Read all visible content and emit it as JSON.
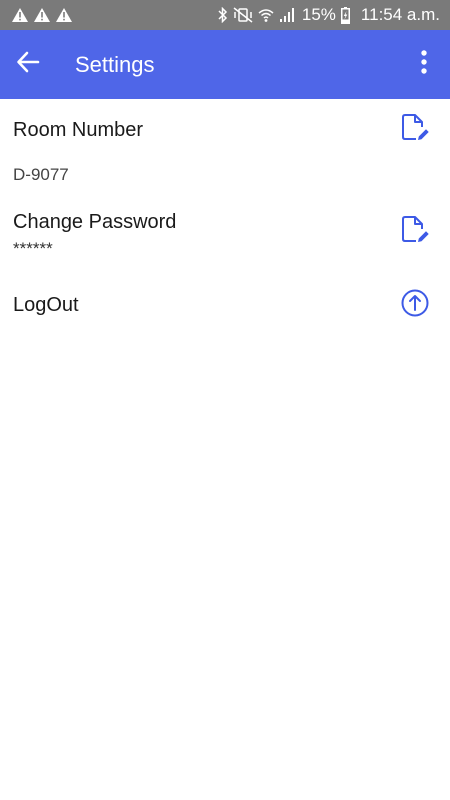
{
  "status_bar": {
    "battery": "15%",
    "time": "11:54 a.m."
  },
  "app_bar": {
    "title": "Settings"
  },
  "settings": {
    "room": {
      "label": "Room Number",
      "value": "D-9077"
    },
    "password": {
      "label": "Change Password",
      "value": "******"
    },
    "logout": {
      "label": "LogOut"
    }
  },
  "colors": {
    "accent": "#4f66e8",
    "status_bar": "#7a7a7a",
    "icon": "#3d5ae6"
  },
  "icons": {
    "back": "arrow-back-icon",
    "more": "more-vert-icon",
    "edit": "edit-document-icon",
    "logout": "upload-circle-icon"
  }
}
